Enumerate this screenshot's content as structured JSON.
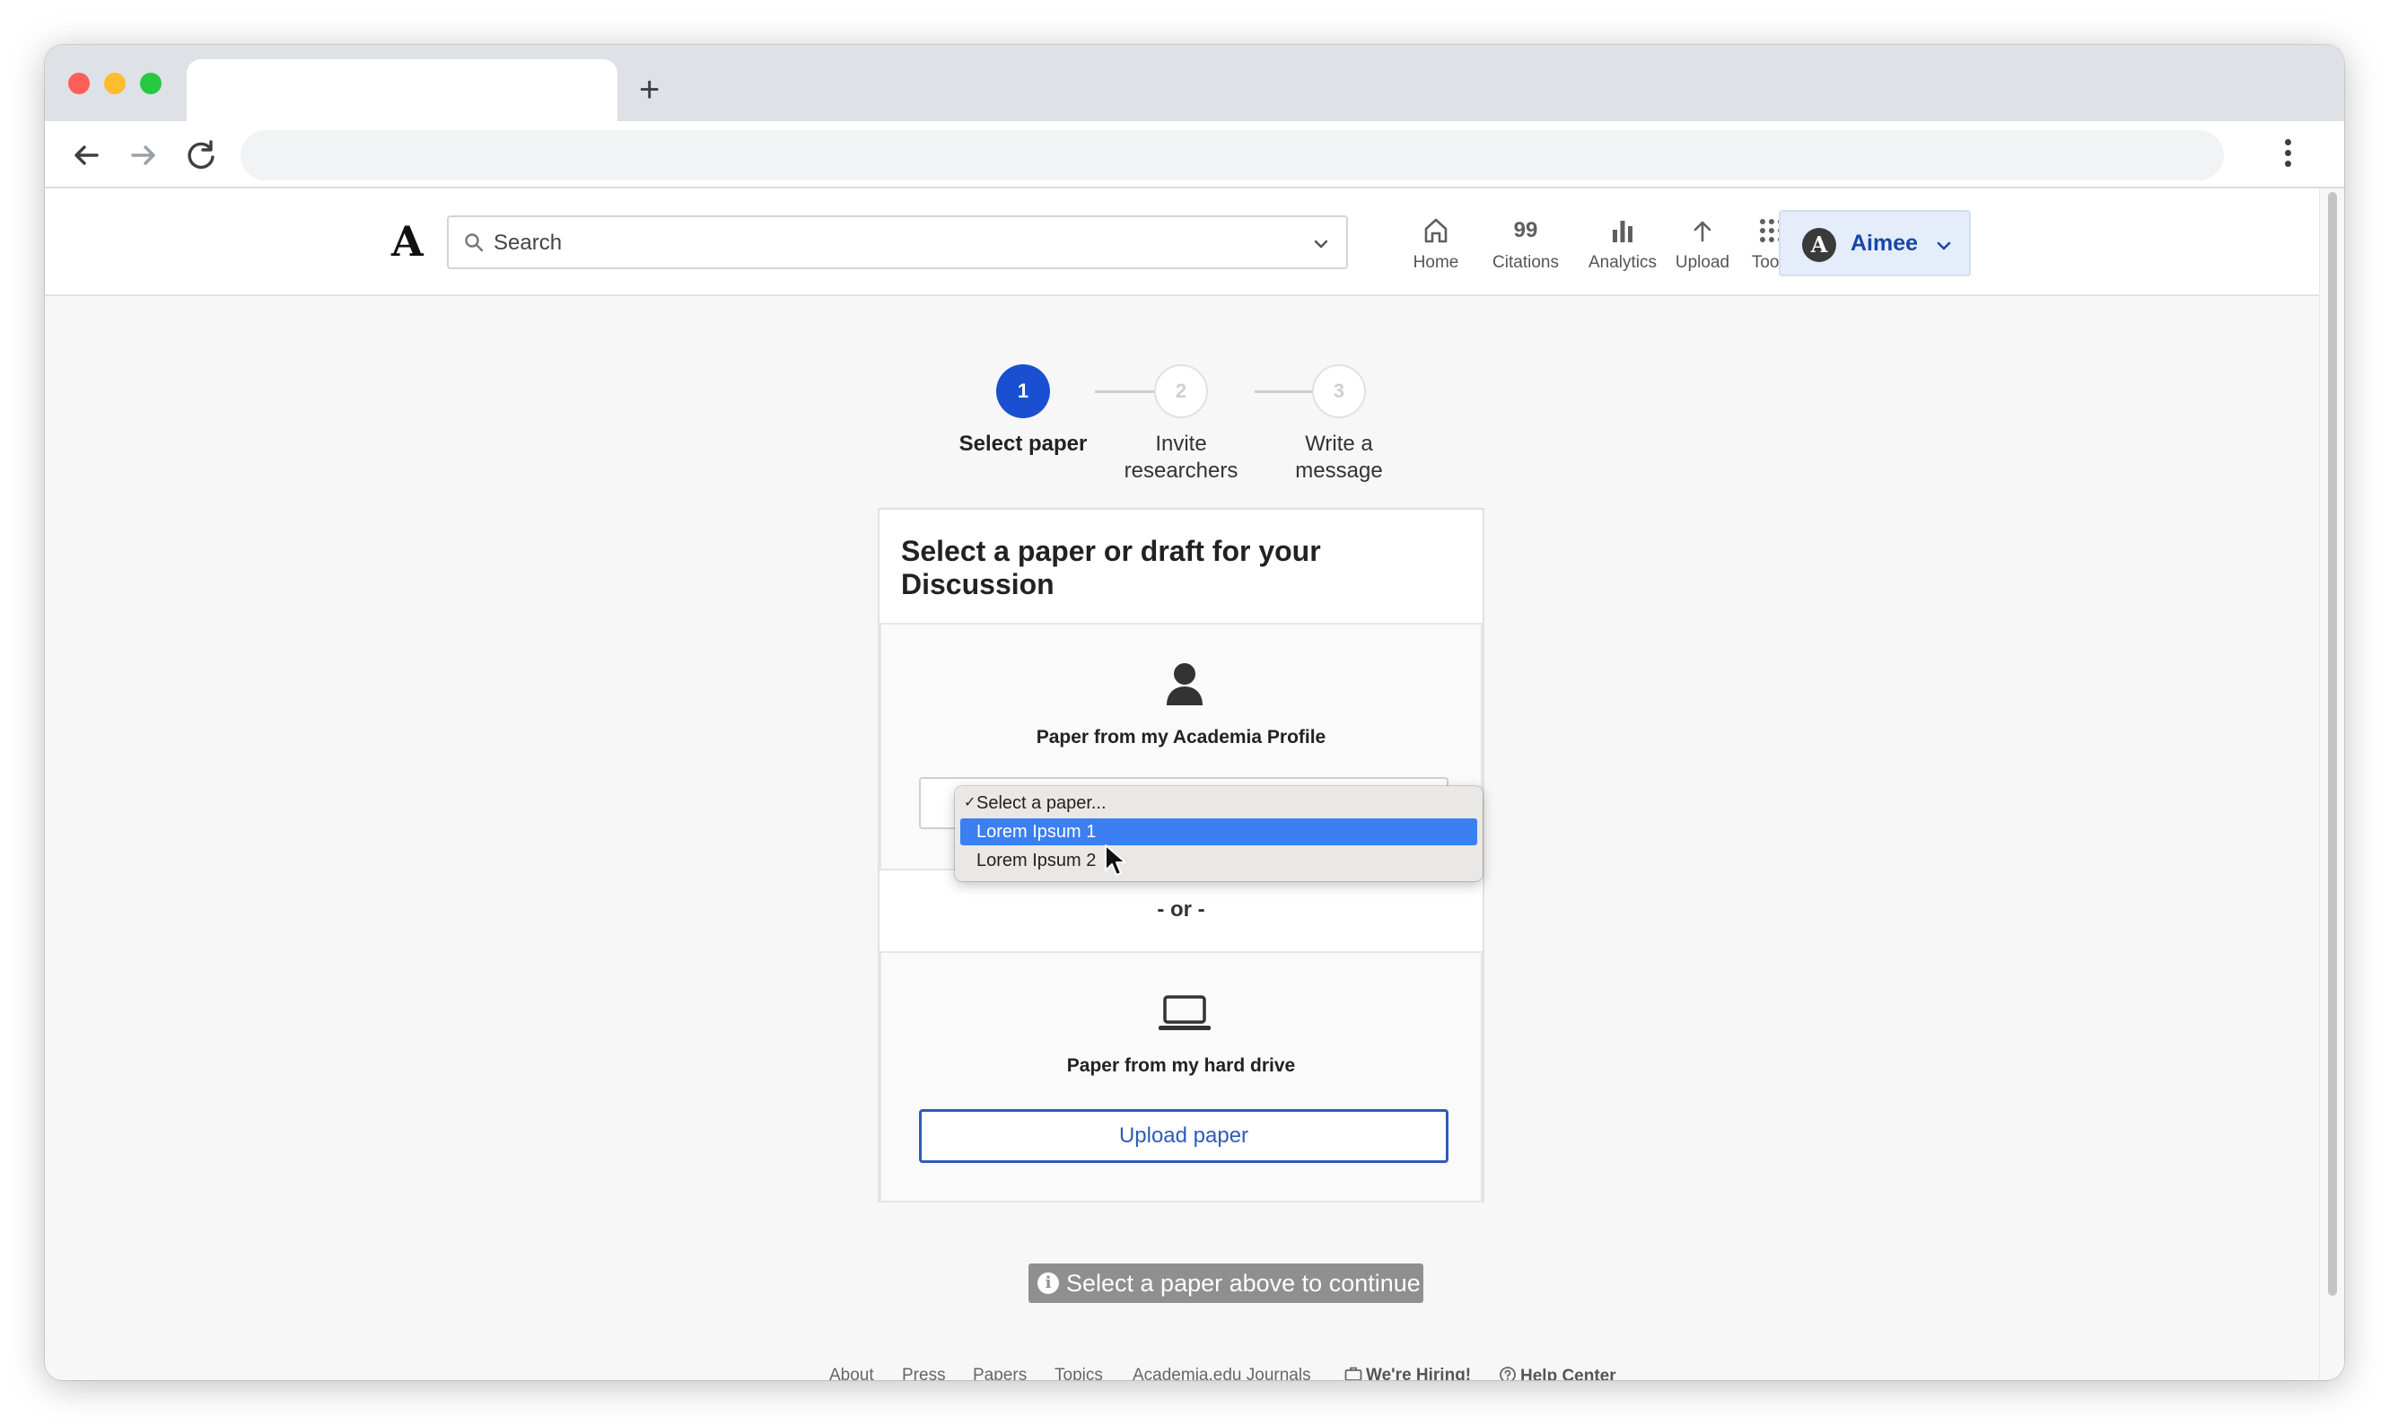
{
  "browser": {
    "new_tab_symbol": "+",
    "tab_title": "",
    "address": ""
  },
  "header": {
    "logo": "A",
    "search_placeholder": "Search",
    "nav": [
      {
        "label": "Home",
        "icon": "home-icon"
      },
      {
        "label": "Citations",
        "icon": "citations-icon",
        "glyph": "99"
      },
      {
        "label": "Analytics",
        "icon": "analytics-icon"
      },
      {
        "label": "Upload",
        "icon": "upload-arrow-icon"
      },
      {
        "label": "Tools",
        "icon": "grid-icon"
      }
    ],
    "user": {
      "initial": "A",
      "name": "Aimee"
    }
  },
  "stepper": [
    {
      "number": "1",
      "label": "Select paper",
      "active": true
    },
    {
      "number": "2",
      "label": "Invite researchers",
      "active": false
    },
    {
      "number": "3",
      "label": "Write a message",
      "active": false
    }
  ],
  "card": {
    "title": "Select a paper or draft for your Discussion",
    "profile_panel": {
      "icon": "person-icon",
      "title": "Paper from my Academia Profile",
      "select": {
        "options": [
          "Select a paper...",
          "Lorem Ipsum 1",
          "Lorem Ipsum 2"
        ],
        "checked": "Select a paper...",
        "highlighted": "Lorem Ipsum 1"
      }
    },
    "or_text": "- or -",
    "drive_panel": {
      "icon": "laptop-icon",
      "title": "Paper from my hard drive",
      "button": "Upload paper"
    }
  },
  "hint": "Select a paper above to continue",
  "footer": {
    "links": [
      "About",
      "Press",
      "Papers",
      "Topics",
      "Academia.edu Journals"
    ],
    "hiring": "We're Hiring!",
    "help": "Help Center"
  },
  "colors": {
    "accent": "#1a4fd1",
    "button_border": "#2e5bb8",
    "dropdown_highlight": "#3b7ff0"
  }
}
